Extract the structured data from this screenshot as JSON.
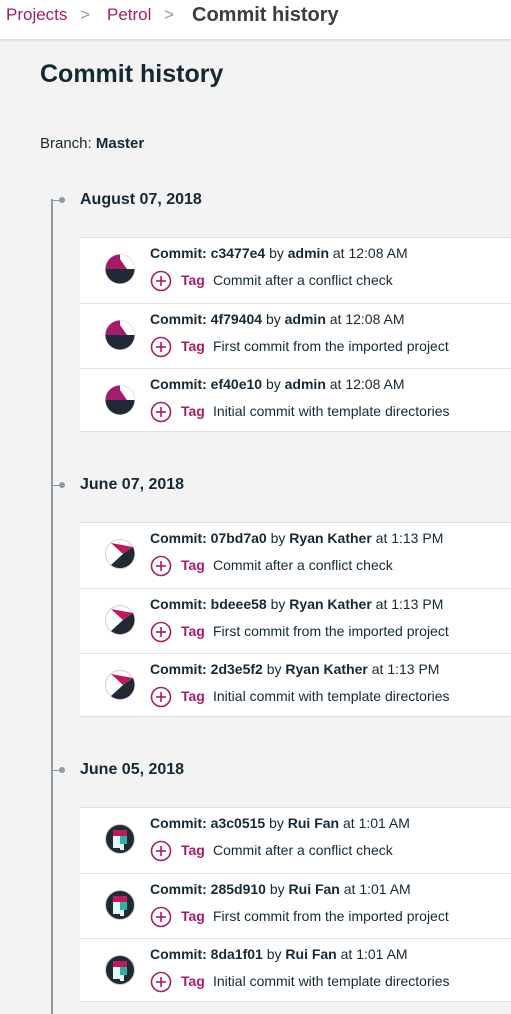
{
  "breadcrumb": {
    "items": [
      "Projects",
      "Petrol"
    ],
    "separator": ">",
    "current": "Commit history"
  },
  "page": {
    "title": "Commit history",
    "branch_label": "Branch:",
    "branch_value": "Master"
  },
  "colors": {
    "link": "#a51c6b",
    "text": "#152935",
    "timeline": "#8c9ba5"
  },
  "groups": [
    {
      "date": "August 07, 2018",
      "avatar": "avatar-pie-magenta",
      "commits": [
        {
          "prefix": "Commit:",
          "hash": "c3477e4",
          "by": "by",
          "author": "admin",
          "at": "at 12:08 AM",
          "tag": "Tag",
          "message": "Commit after a conflict check"
        },
        {
          "prefix": "Commit:",
          "hash": "4f79404",
          "by": "by",
          "author": "admin",
          "at": "at 12:08 AM",
          "tag": "Tag",
          "message": "First commit from the imported project"
        },
        {
          "prefix": "Commit:",
          "hash": "ef40e10",
          "by": "by",
          "author": "admin",
          "at": "at 12:08 AM",
          "tag": "Tag",
          "message": "Initial commit with template directories"
        }
      ]
    },
    {
      "date": "June 07, 2018",
      "avatar": "avatar-triangle-magenta",
      "commits": [
        {
          "prefix": "Commit:",
          "hash": "07bd7a0",
          "by": "by",
          "author": "Ryan Kather",
          "at": "at 1:13 PM",
          "tag": "Tag",
          "message": "Commit after a conflict check"
        },
        {
          "prefix": "Commit:",
          "hash": "bdeee58",
          "by": "by",
          "author": "Ryan Kather",
          "at": "at 1:13 PM",
          "tag": "Tag",
          "message": "First commit from the imported project"
        },
        {
          "prefix": "Commit:",
          "hash": "2d3e5f2",
          "by": "by",
          "author": "Ryan Kather",
          "at": "at 1:13 PM",
          "tag": "Tag",
          "message": "Initial commit with template directories"
        }
      ]
    },
    {
      "date": "June 05, 2018",
      "avatar": "avatar-blocks-teal",
      "commits": [
        {
          "prefix": "Commit:",
          "hash": "a3c0515",
          "by": "by",
          "author": "Rui Fan",
          "at": "at 1:01 AM",
          "tag": "Tag",
          "message": "Commit after a conflict check"
        },
        {
          "prefix": "Commit:",
          "hash": "285d910",
          "by": "by",
          "author": "Rui Fan",
          "at": "at 1:01 AM",
          "tag": "Tag",
          "message": "First commit from the imported project"
        },
        {
          "prefix": "Commit:",
          "hash": "8da1f01",
          "by": "by",
          "author": "Rui Fan",
          "at": "at 1:01 AM",
          "tag": "Tag",
          "message": "Initial commit with template directories"
        }
      ]
    }
  ]
}
